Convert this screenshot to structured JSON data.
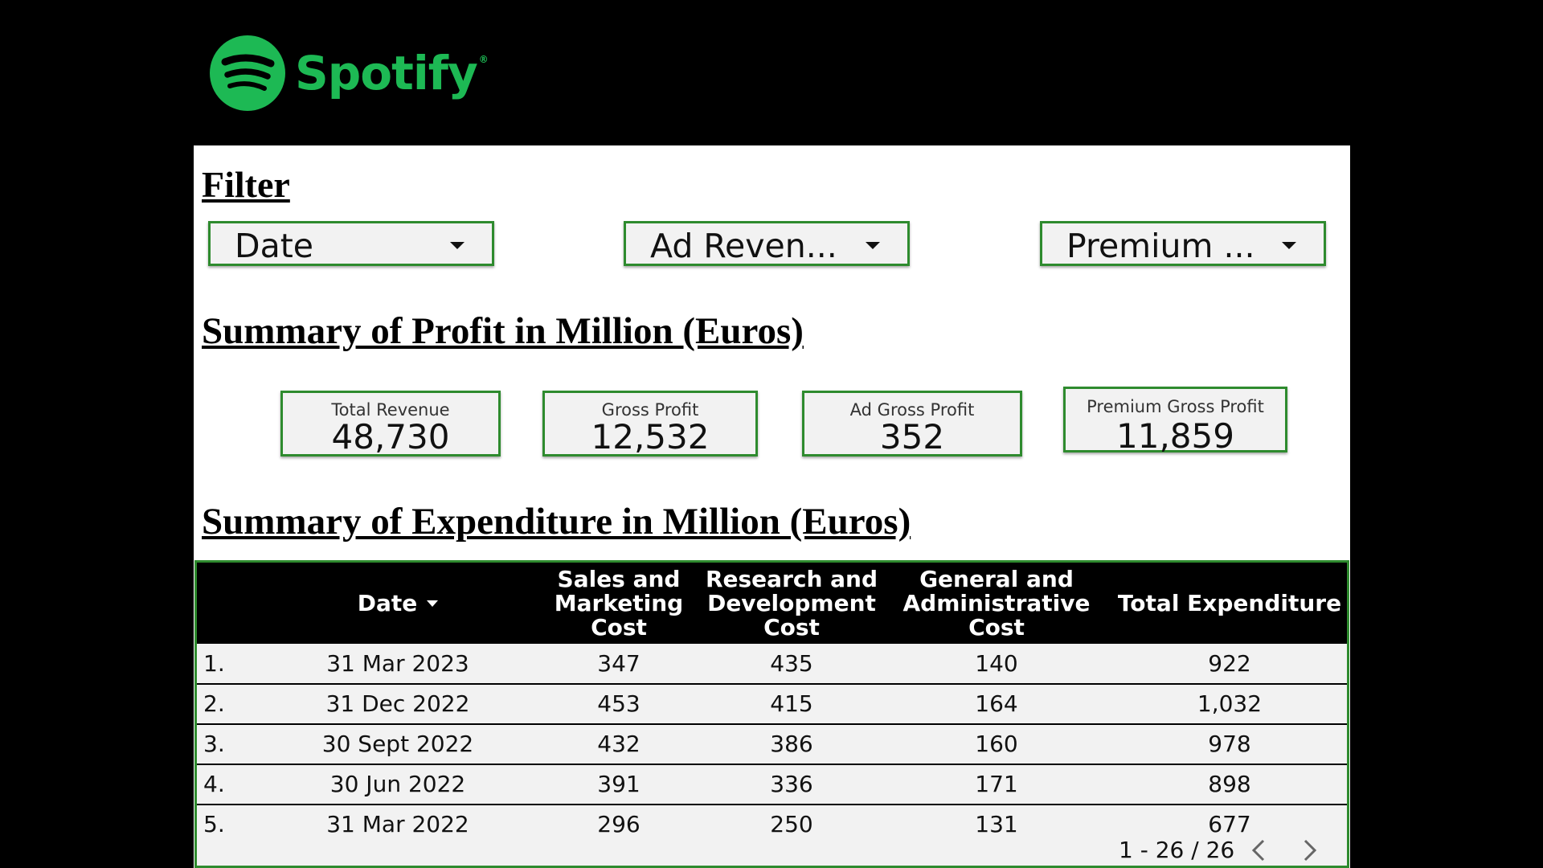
{
  "brand": {
    "name": "Spotify",
    "trademark": "®",
    "color": "#1DB954",
    "icon": "spotify-logo-icon"
  },
  "filter": {
    "heading": "Filter",
    "dropdowns": [
      {
        "label": "Date",
        "icon": "chevron-down-icon"
      },
      {
        "label": "Ad Reven...",
        "icon": "chevron-down-icon"
      },
      {
        "label": "Premium ...",
        "icon": "chevron-down-icon"
      }
    ]
  },
  "profit": {
    "heading": "Summary of Profit in Million (Euros)",
    "kpis": [
      {
        "label": "Total Revenue",
        "value": "48,730"
      },
      {
        "label": "Gross Profit",
        "value": "12,532"
      },
      {
        "label": "Ad Gross Profit",
        "value": "352"
      },
      {
        "label": "Premium Gross Profit",
        "value": "11,859"
      }
    ]
  },
  "expenditure": {
    "heading": "Summary of Expenditure in Million (Euros)",
    "columns": [
      "Date",
      "Sales and Marketing Cost",
      "Research and Development Cost",
      "General and Administrative Cost",
      "Total Expenditure"
    ],
    "rows": [
      {
        "index": "1.",
        "date": "31 Mar 2023",
        "sales": "347",
        "rnd": "435",
        "general": "140",
        "total": "922"
      },
      {
        "index": "2.",
        "date": "31 Dec 2022",
        "sales": "453",
        "rnd": "415",
        "general": "164",
        "total": "1,032"
      },
      {
        "index": "3.",
        "date": "30 Sept 2022",
        "sales": "432",
        "rnd": "386",
        "general": "160",
        "total": "978"
      },
      {
        "index": "4.",
        "date": "30 Jun 2022",
        "sales": "391",
        "rnd": "336",
        "general": "171",
        "total": "898"
      },
      {
        "index": "5.",
        "date": "31 Mar 2022",
        "sales": "296",
        "rnd": "250",
        "general": "131",
        "total": "677"
      }
    ],
    "pagination": {
      "text": "1 - 26 / 26",
      "prev_icon": "chevron-left-icon",
      "next_icon": "chevron-right-icon"
    }
  },
  "colors": {
    "background": "#000000",
    "panel": "#ffffff",
    "border_green": "#2e8b2e",
    "card_bg": "#f2f2f2"
  }
}
